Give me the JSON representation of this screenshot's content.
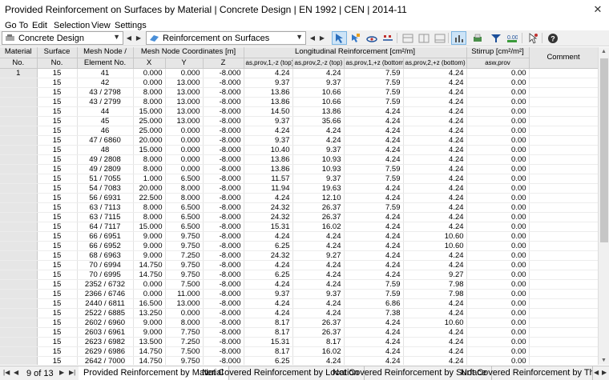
{
  "window": {
    "title": "Provided Reinforcement on Surfaces by Material | Concrete Design | EN 1992 | CEN | 2014-11",
    "close": "✕"
  },
  "menu": [
    "Go To",
    "Edit",
    "Selection",
    "View",
    "Settings"
  ],
  "toolbar": {
    "module": "Concrete Design",
    "table": "Reinforcement on Surfaces"
  },
  "headers": {
    "material": "Material",
    "material_no": "No.",
    "surface": "Surface",
    "surface_no": "No.",
    "mesh": "Mesh Node /",
    "mesh_el": "Element No.",
    "coords": "Mesh Node Coordinates [m]",
    "x": "X",
    "y": "Y",
    "z": "Z",
    "long": "Longitudinal Reinforcement [cm²/m]",
    "a1": "as,prov,1,-z (top)",
    "a2": "as,prov,2,-z (top)",
    "a3": "as,prov,1,+z (bottom)",
    "a4": "as,prov,2,+z (bottom)",
    "stirrup": "Stirrup [cm²/m²]",
    "asw": "asw,prov",
    "comment": "Comment"
  },
  "rows": [
    [
      "1",
      "15",
      "41",
      "0.000",
      "0.000",
      "-8.000",
      "4.24",
      "4.24",
      "7.59",
      "4.24",
      "0.00"
    ],
    [
      "",
      "15",
      "42",
      "0.000",
      "13.000",
      "-8.000",
      "9.37",
      "9.37",
      "7.59",
      "4.24",
      "0.00"
    ],
    [
      "",
      "15",
      "43 / 2798",
      "8.000",
      "13.000",
      "-8.000",
      "13.86",
      "10.66",
      "7.59",
      "4.24",
      "0.00"
    ],
    [
      "",
      "15",
      "43 / 2799",
      "8.000",
      "13.000",
      "-8.000",
      "13.86",
      "10.66",
      "7.59",
      "4.24",
      "0.00"
    ],
    [
      "",
      "15",
      "44",
      "15.000",
      "13.000",
      "-8.000",
      "14.50",
      "13.86",
      "4.24",
      "4.24",
      "0.00"
    ],
    [
      "",
      "15",
      "45",
      "25.000",
      "13.000",
      "-8.000",
      "9.37",
      "35.66",
      "4.24",
      "4.24",
      "0.00"
    ],
    [
      "",
      "15",
      "46",
      "25.000",
      "0.000",
      "-8.000",
      "4.24",
      "4.24",
      "4.24",
      "4.24",
      "0.00"
    ],
    [
      "",
      "15",
      "47 / 6860",
      "20.000",
      "0.000",
      "-8.000",
      "9.37",
      "4.24",
      "4.24",
      "4.24",
      "0.00"
    ],
    [
      "",
      "15",
      "48",
      "15.000",
      "0.000",
      "-8.000",
      "10.40",
      "9.37",
      "4.24",
      "4.24",
      "0.00"
    ],
    [
      "",
      "15",
      "49 / 2808",
      "8.000",
      "0.000",
      "-8.000",
      "13.86",
      "10.93",
      "4.24",
      "4.24",
      "0.00"
    ],
    [
      "",
      "15",
      "49 / 2809",
      "8.000",
      "0.000",
      "-8.000",
      "13.86",
      "10.93",
      "7.59",
      "4.24",
      "0.00"
    ],
    [
      "",
      "15",
      "51 / 7055",
      "1.000",
      "6.500",
      "-8.000",
      "11.57",
      "9.37",
      "7.59",
      "4.24",
      "0.00"
    ],
    [
      "",
      "15",
      "54 / 7083",
      "20.000",
      "8.000",
      "-8.000",
      "11.94",
      "19.63",
      "4.24",
      "4.24",
      "0.00"
    ],
    [
      "",
      "15",
      "56 / 6931",
      "22.500",
      "8.000",
      "-8.000",
      "4.24",
      "12.10",
      "4.24",
      "4.24",
      "0.00"
    ],
    [
      "",
      "15",
      "63 / 7113",
      "8.000",
      "6.500",
      "-8.000",
      "24.32",
      "26.37",
      "7.59",
      "4.24",
      "0.00"
    ],
    [
      "",
      "15",
      "63 / 7115",
      "8.000",
      "6.500",
      "-8.000",
      "24.32",
      "26.37",
      "4.24",
      "4.24",
      "0.00"
    ],
    [
      "",
      "15",
      "64 / 7117",
      "15.000",
      "6.500",
      "-8.000",
      "15.31",
      "16.02",
      "4.24",
      "4.24",
      "0.00"
    ],
    [
      "",
      "15",
      "66 / 6951",
      "9.000",
      "9.750",
      "-8.000",
      "4.24",
      "4.24",
      "4.24",
      "10.60",
      "0.00"
    ],
    [
      "",
      "15",
      "66 / 6952",
      "9.000",
      "9.750",
      "-8.000",
      "6.25",
      "4.24",
      "4.24",
      "10.60",
      "0.00"
    ],
    [
      "",
      "15",
      "68 / 6963",
      "9.000",
      "7.250",
      "-8.000",
      "24.32",
      "9.27",
      "4.24",
      "4.24",
      "0.00"
    ],
    [
      "",
      "15",
      "70 / 6994",
      "14.750",
      "9.750",
      "-8.000",
      "4.24",
      "4.24",
      "4.24",
      "4.24",
      "0.00"
    ],
    [
      "",
      "15",
      "70 / 6995",
      "14.750",
      "9.750",
      "-8.000",
      "6.25",
      "4.24",
      "4.24",
      "9.27",
      "0.00"
    ],
    [
      "",
      "15",
      "2352 / 6732",
      "0.000",
      "7.500",
      "-8.000",
      "4.24",
      "4.24",
      "7.59",
      "7.98",
      "0.00"
    ],
    [
      "",
      "15",
      "2366 / 6746",
      "0.000",
      "11.000",
      "-8.000",
      "9.37",
      "9.37",
      "7.59",
      "7.98",
      "0.00"
    ],
    [
      "",
      "15",
      "2440 / 6811",
      "16.500",
      "13.000",
      "-8.000",
      "4.24",
      "4.24",
      "6.86",
      "4.24",
      "0.00"
    ],
    [
      "",
      "15",
      "2522 / 6885",
      "13.250",
      "0.000",
      "-8.000",
      "4.24",
      "4.24",
      "7.38",
      "4.24",
      "0.00"
    ],
    [
      "",
      "15",
      "2602 / 6960",
      "9.000",
      "8.000",
      "-8.000",
      "8.17",
      "26.37",
      "4.24",
      "10.60",
      "0.00"
    ],
    [
      "",
      "15",
      "2603 / 6961",
      "9.000",
      "7.750",
      "-8.000",
      "8.17",
      "26.37",
      "4.24",
      "4.24",
      "0.00"
    ],
    [
      "",
      "15",
      "2623 / 6982",
      "13.500",
      "7.250",
      "-8.000",
      "15.31",
      "8.17",
      "4.24",
      "4.24",
      "0.00"
    ],
    [
      "",
      "15",
      "2629 / 6986",
      "14.750",
      "7.500",
      "-8.000",
      "8.17",
      "16.02",
      "4.24",
      "4.24",
      "0.00"
    ],
    [
      "",
      "15",
      "2642 / 7000",
      "14.750",
      "9.750",
      "-8.000",
      "6.25",
      "4.24",
      "4.24",
      "4.24",
      "0.00"
    ]
  ],
  "tabbar": {
    "page": "9 of 13",
    "tabs": [
      "Provided Reinforcement by Material",
      "Not Covered Reinforcement by Location",
      "Not Covered Reinforcement by Surface",
      "Not Covered Reinforcement by Thickness"
    ]
  }
}
